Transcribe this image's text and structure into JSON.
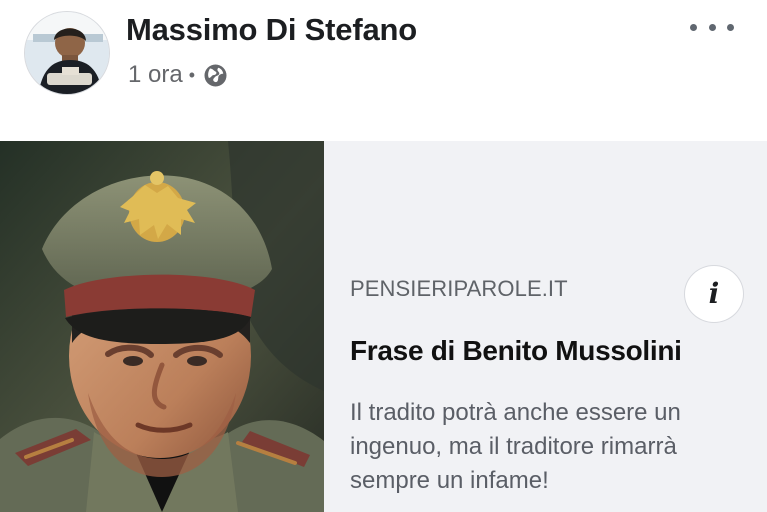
{
  "post": {
    "author": {
      "name": "Massimo Di Stefano"
    },
    "timestamp": "1 ora",
    "separator": "•",
    "privacy_icon": "globe-icon",
    "more_icon": "more-horizontal-icon"
  },
  "link_card": {
    "image_subject": "portrait photograph",
    "domain": "PENSIERIPAROLE.IT",
    "title": "Frase di Benito Mussolini",
    "description": "Il tradito potrà anche essere un ingenuo, ma il traditore rimarrà sempre un infame!",
    "info_icon": "info-icon",
    "info_glyph": "i"
  },
  "colors": {
    "name": "#1c1e21",
    "meta": "#65676b",
    "card_background": "#f1f2f5",
    "domain": "#5f6368",
    "title": "#111111",
    "description": "#5a5e66"
  }
}
